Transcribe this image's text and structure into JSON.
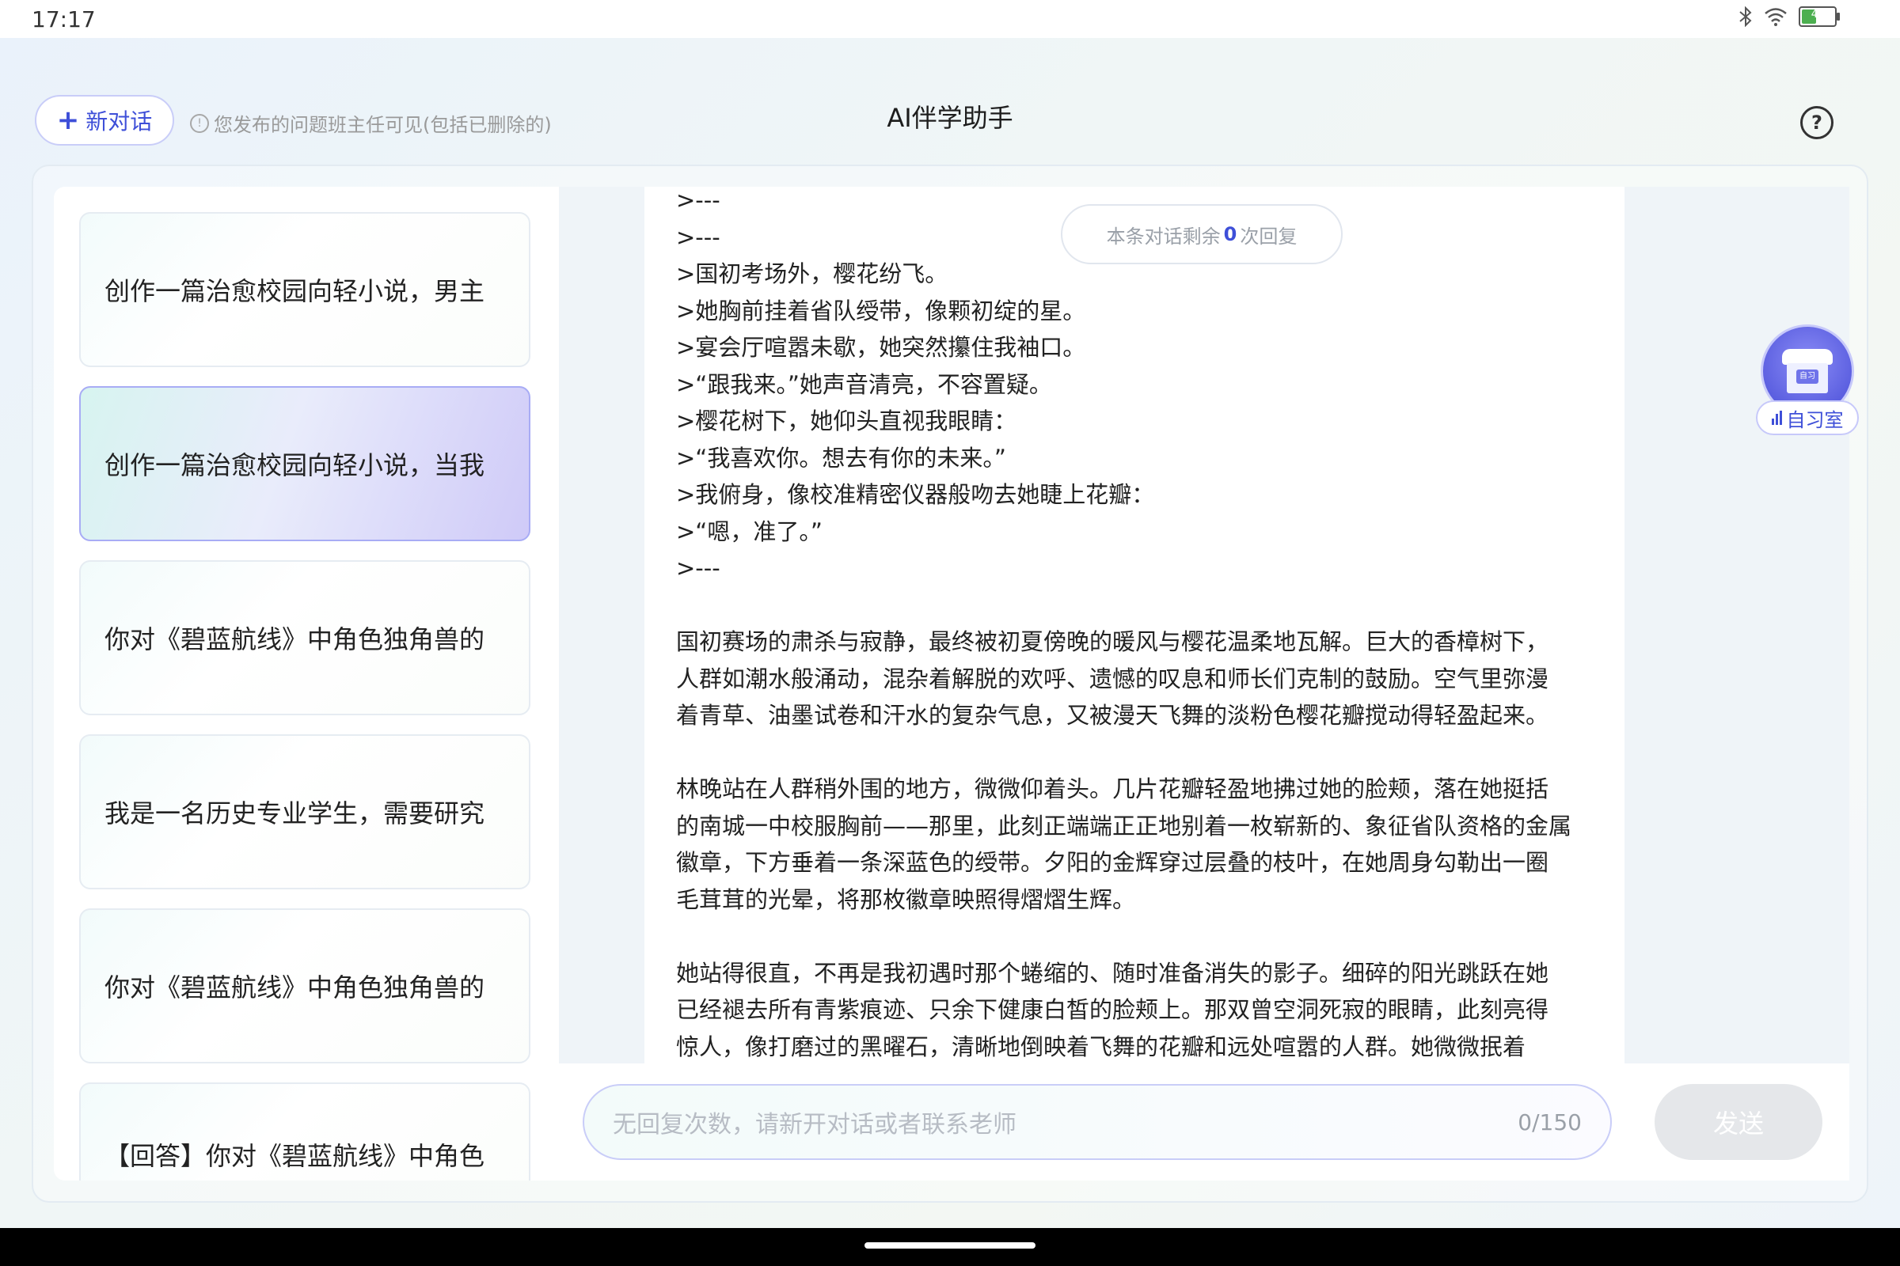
{
  "status_bar": {
    "time": "17:17",
    "battery_percent": "46",
    "battery_level": 0.46,
    "icons": [
      "bluetooth-icon",
      "wifi-icon",
      "battery-icon"
    ]
  },
  "header": {
    "new_chat_label": "新对话",
    "notice": "您发布的问题班主任可见(包括已删除的)",
    "title": "AI伴学助手",
    "help_symbol": "?"
  },
  "conversations": [
    {
      "label": "创作一篇治愈校园向轻小说，男主",
      "active": false
    },
    {
      "label": "创作一篇治愈校园向轻小说，当我",
      "active": true
    },
    {
      "label": "你对《碧蓝航线》中角色独角兽的",
      "active": false
    },
    {
      "label": "我是一名历史专业学生，需要研究",
      "active": false
    },
    {
      "label": "你对《碧蓝航线》中角色独角兽的",
      "active": false
    },
    {
      "label": "【回答】你对《碧蓝航线》中角色",
      "active": false
    }
  ],
  "remaining": {
    "prefix": "本条对话剩余",
    "count": "0",
    "suffix": "次回复"
  },
  "message": {
    "lines": [
      ">---",
      ">---",
      ">国初考场外，樱花纷飞。",
      ">她胸前挂着省队绶带，像颗初绽的星。",
      ">宴会厅喧嚣未歇，她突然攥住我袖口。",
      ">“跟我来。”她声音清亮，不容置疑。",
      ">樱花树下，她仰头直视我眼睛：",
      ">“我喜欢你。想去有你的未来。”",
      ">我俯身，像校准精密仪器般吻去她睫上花瓣：",
      ">“嗯，准了。”",
      ">---",
      "",
      "国初赛场的肃杀与寂静，最终被初夏傍晚的暖风与樱花温柔地瓦解。巨大的香樟树下，",
      "人群如潮水般涌动，混杂着解脱的欢呼、遗憾的叹息和师长们克制的鼓励。空气里弥漫",
      "着青草、油墨试卷和汗水的复杂气息，又被漫天飞舞的淡粉色樱花瓣搅动得轻盈起来。",
      "",
      "林晚站在人群稍外围的地方，微微仰着头。几片花瓣轻盈地拂过她的脸颊，落在她挺括",
      "的南城一中校服胸前——那里，此刻正端端正正地别着一枚崭新的、象征省队资格的金属",
      "徽章，下方垂着一条深蓝色的绶带。夕阳的金辉穿过层叠的枝叶，在她周身勾勒出一圈",
      "毛茸茸的光晕，将那枚徽章映照得熠熠生辉。",
      "",
      "她站得很直，不再是我初遇时那个蜷缩的、随时准备消失的影子。细碎的阳光跳跃在她",
      "已经褪去所有青紫痕迹、只余下健康白皙的脸颊上。那双曾空洞死寂的眼睛，此刻亮得",
      "惊人，像打磨过的黑曜石，清晰地倒映着飞舞的花瓣和远处喧嚣的人群。她微微抿着"
    ]
  },
  "study_room": {
    "label": "自习室",
    "sign": "自习"
  },
  "input": {
    "placeholder": "无回复次数，请新开对话或者联系老师",
    "counter": "0/150",
    "send_label": "发送"
  },
  "colors": {
    "accent": "#3e4fd8",
    "active_item_gradient_end": "#cfcaf8",
    "send_disabled": "#e5e7ea"
  }
}
